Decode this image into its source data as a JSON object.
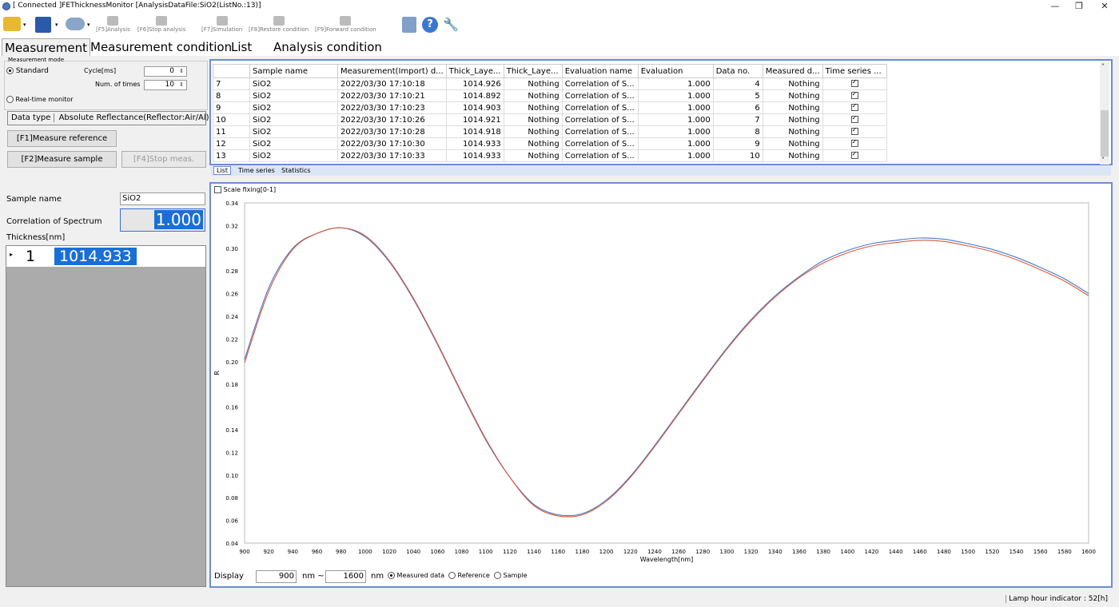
{
  "window": {
    "title": "[ Connected ]FEThicknessMonitor [AnalysisDataFile:SiO2(ListNo.:13)]",
    "minimize": "—",
    "restore": "❐",
    "close": "✕"
  },
  "toolbar": {
    "analysis": "[F5]Analysis",
    "stop_analysis": "[F6]Stop analysis",
    "simulation": "[F7]Simulation",
    "restore": "[F8]Restore condition",
    "forward": "[F9]Forward condition"
  },
  "tabs": [
    "Measurement",
    "Measurement condition",
    "List",
    "Analysis condition"
  ],
  "left": {
    "mode_title": "Measurement mode",
    "standard": "Standard",
    "cycle_label": "Cycle[ms]",
    "cycle_value": "0",
    "times_label": "Num. of times",
    "times_value": "10",
    "realtime": "Real-time monitor",
    "datatype_label": "Data type",
    "datatype_value": "Absolute Reflectance(Reflector:Air/Al)",
    "btn_ref": "[F1]Measure reference",
    "btn_sample": "[F2]Measure sample",
    "btn_stop": "[F4]Stop meas.",
    "sample_name_label": "Sample name",
    "sample_name_value": "SiO2",
    "corr_label": "Correlation of Spectrum",
    "corr_value": "1.000",
    "thickness_label": "Thickness[nm]",
    "thickness_row_no": "1",
    "thickness_row_val": "1014.933"
  },
  "table": {
    "headers": [
      "",
      "Sample name",
      "Measurement(Import) d...",
      "Thick_Laye...",
      "Thick_Laye...",
      "Evaluation name",
      "Evaluation",
      "Data no.",
      "Measured d...",
      "Time series ..."
    ],
    "rows": [
      [
        "7",
        "SiO2",
        "2022/03/30 17:10:18",
        "1014.926",
        "Nothing",
        "Correlation of S...",
        "1.000",
        "4",
        "Nothing"
      ],
      [
        "8",
        "SiO2",
        "2022/03/30 17:10:21",
        "1014.892",
        "Nothing",
        "Correlation of S...",
        "1.000",
        "5",
        "Nothing"
      ],
      [
        "9",
        "SiO2",
        "2022/03/30 17:10:23",
        "1014.903",
        "Nothing",
        "Correlation of S...",
        "1.000",
        "6",
        "Nothing"
      ],
      [
        "10",
        "SiO2",
        "2022/03/30 17:10:26",
        "1014.921",
        "Nothing",
        "Correlation of S...",
        "1.000",
        "7",
        "Nothing"
      ],
      [
        "11",
        "SiO2",
        "2022/03/30 17:10:28",
        "1014.918",
        "Nothing",
        "Correlation of S...",
        "1.000",
        "8",
        "Nothing"
      ],
      [
        "12",
        "SiO2",
        "2022/03/30 17:10:30",
        "1014.933",
        "Nothing",
        "Correlation of S...",
        "1.000",
        "9",
        "Nothing"
      ],
      [
        "13",
        "SiO2",
        "2022/03/30 17:10:33",
        "1014.933",
        "Nothing",
        "Correlation of S...",
        "1.000",
        "10",
        "Nothing"
      ]
    ]
  },
  "subtabs": [
    "List",
    "Time series",
    "Statistics"
  ],
  "chart": {
    "scale_fixing": "Scale fixing[0-1]",
    "display_label": "Display",
    "from_value": "900",
    "to_value": "1600",
    "nm_dash": "nm ~",
    "nm": "nm",
    "radio_measured": "Measured data",
    "radio_reference": "Reference",
    "radio_sample": "Sample"
  },
  "chart_data": {
    "type": "line",
    "xlabel": "Wavelength[nm]",
    "ylabel": "R",
    "xlim": [
      900,
      1600
    ],
    "ylim": [
      0.04,
      0.34
    ],
    "x_ticks": [
      900,
      920,
      940,
      960,
      980,
      1000,
      1020,
      1040,
      1060,
      1080,
      1100,
      1120,
      1140,
      1160,
      1180,
      1200,
      1220,
      1240,
      1260,
      1280,
      1300,
      1320,
      1340,
      1360,
      1380,
      1400,
      1420,
      1440,
      1460,
      1480,
      1500,
      1520,
      1540,
      1560,
      1580,
      1600
    ],
    "y_ticks": [
      "0.04",
      "0.06",
      "0.08",
      "0.10",
      "0.12",
      "0.14",
      "0.16",
      "0.18",
      "0.20",
      "0.22",
      "0.24",
      "0.26",
      "0.28",
      "0.30",
      "0.32",
      "0.34"
    ],
    "series": [
      {
        "color": "#4a78c8",
        "x": [
          900,
          920,
          940,
          960,
          980,
          1000,
          1020,
          1040,
          1060,
          1080,
          1100,
          1120,
          1140,
          1160,
          1180,
          1200,
          1220,
          1240,
          1260,
          1280,
          1300,
          1320,
          1340,
          1360,
          1380,
          1400,
          1420,
          1440,
          1460,
          1480,
          1500,
          1520,
          1540,
          1560,
          1580,
          1600
        ],
        "y": [
          0.202,
          0.265,
          0.3,
          0.313,
          0.318,
          0.31,
          0.288,
          0.255,
          0.215,
          0.172,
          0.131,
          0.098,
          0.074,
          0.065,
          0.066,
          0.078,
          0.099,
          0.126,
          0.155,
          0.184,
          0.212,
          0.237,
          0.258,
          0.275,
          0.289,
          0.298,
          0.304,
          0.307,
          0.309,
          0.308,
          0.304,
          0.299,
          0.292,
          0.283,
          0.273,
          0.26
        ]
      },
      {
        "color": "#d85a3c",
        "x": [
          900,
          920,
          940,
          960,
          980,
          1000,
          1020,
          1040,
          1060,
          1080,
          1100,
          1120,
          1140,
          1160,
          1180,
          1200,
          1220,
          1240,
          1260,
          1280,
          1300,
          1320,
          1340,
          1360,
          1380,
          1400,
          1420,
          1440,
          1460,
          1480,
          1500,
          1520,
          1540,
          1560,
          1580,
          1600
        ],
        "y": [
          0.199,
          0.262,
          0.299,
          0.313,
          0.318,
          0.311,
          0.289,
          0.256,
          0.216,
          0.173,
          0.132,
          0.098,
          0.073,
          0.064,
          0.065,
          0.077,
          0.098,
          0.125,
          0.154,
          0.183,
          0.211,
          0.236,
          0.257,
          0.274,
          0.287,
          0.296,
          0.302,
          0.305,
          0.307,
          0.306,
          0.302,
          0.297,
          0.29,
          0.281,
          0.271,
          0.258
        ]
      }
    ]
  },
  "status": {
    "lamp": "Lamp hour indicator : 52[h]"
  }
}
